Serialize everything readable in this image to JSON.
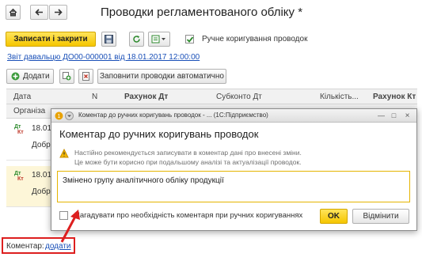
{
  "window": {
    "title": "Проводки регламентованого обліку *",
    "home_icon": "house-icon",
    "back_icon": "arrow-left-icon",
    "forward_icon": "arrow-right-icon"
  },
  "toolbar": {
    "save_close_label": "Записати і закрити",
    "save_icon": "floppy-disk-icon",
    "refresh_icon": "refresh-icon",
    "structure_icon": "structure-dropdown-icon",
    "manual_edit_label": "Ручне коригування проводок",
    "manual_edit_checked": true
  },
  "source_doc_link": "Звіт давальцю ДО00-000001 від 18.01.2017 12:00:00",
  "table_toolbar": {
    "add_label": "Додати",
    "fill_auto_label": "Заповнити проводки автоматично"
  },
  "grid": {
    "headers": {
      "date": "Дата",
      "n": "N",
      "account_dt": "Рахунок Дт",
      "subconto_dt": "Субконто Дт",
      "quantity": "Кількість...",
      "account_kt": "Рахунок Кт",
      "organization": "Організа"
    },
    "rows": [
      {
        "date": "18.01",
        "line2": "Добр"
      },
      {
        "date": "18.01",
        "line2": "Добр"
      }
    ],
    "dt_label": "Дт",
    "kt_label": "Кт"
  },
  "dialog": {
    "bar_title": "Коментар до ручних коригувань проводок - ... (1С:Підприємство)",
    "title": "Коментар до ручних коригувань проводок",
    "info_line1": "Настійно рекомендується записувати в коментар дані про внесені зміни.",
    "info_line2": "Це може бути корисно при подальшому аналізі та актуалізації проводок.",
    "comment_text": "Змінено групу аналітичного обліку продукції",
    "remind_label": "Нагадувати про необхідність коментаря при ручних коригуваннях",
    "remind_checked": false,
    "ok_label": "OK",
    "cancel_label": "Відмінити"
  },
  "footer": {
    "comment_label": "Коментар:",
    "add_link": "додати"
  },
  "colors": {
    "accent_yellow": "#f5c600",
    "link_blue": "#1a50b8",
    "highlight_red": "#dd1f1f",
    "row_highlight": "#fdf6d8"
  }
}
